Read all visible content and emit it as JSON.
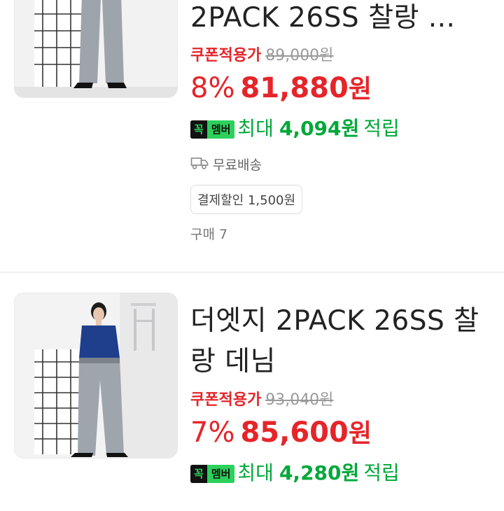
{
  "colors": {
    "sale_red": "#e5252a",
    "member_green": "#00a83a",
    "badge_green": "#2bd15a"
  },
  "products": [
    {
      "title": "2PACK 26SS 찰랑 ...",
      "coupon_label": "쿠폰적용가",
      "original_price": "89,000원",
      "discount": "8%",
      "price": "81,880",
      "price_unit": "원",
      "member_badge": {
        "left": "꼭",
        "right": "멤버"
      },
      "member_max": "최대",
      "member_amount": "4,094원",
      "member_save": "적립",
      "shipping": "무료배송",
      "shipping_icon": "truck-icon",
      "payment_discount": "결제할인 1,500원",
      "purchase_count": "구매 7"
    },
    {
      "title": "더엣지 2PACK 26SS 찰랑 데님",
      "coupon_label": "쿠폰적용가",
      "original_price": "93,040원",
      "discount": "7%",
      "price": "85,600",
      "price_unit": "원",
      "member_badge": {
        "left": "꼭",
        "right": "멤버"
      },
      "member_max": "최대",
      "member_amount": "4,280원",
      "member_save": "적립"
    }
  ]
}
